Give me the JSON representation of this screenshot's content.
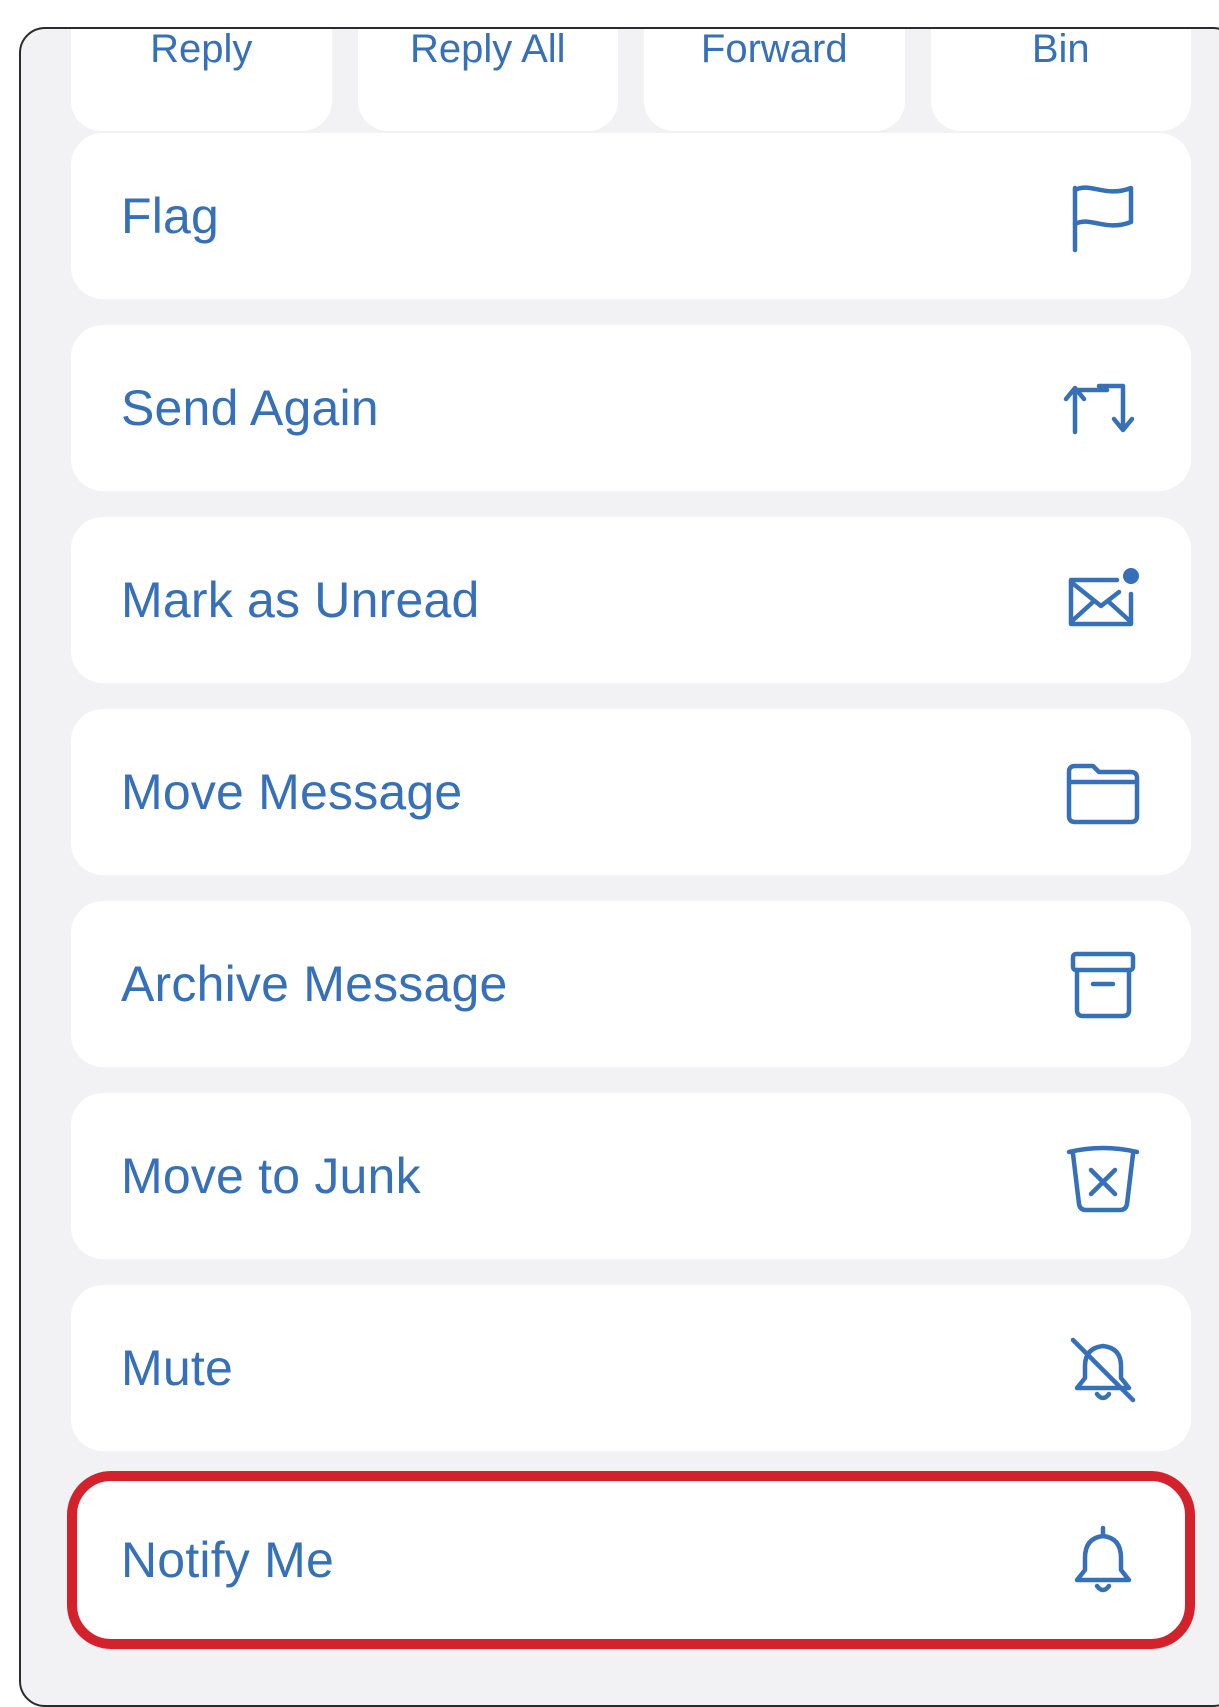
{
  "top_actions": [
    {
      "label": "Reply"
    },
    {
      "label": "Reply All"
    },
    {
      "label": "Forward"
    },
    {
      "label": "Bin"
    }
  ],
  "menu": {
    "items": [
      {
        "label": "Flag",
        "icon": "flag-icon"
      },
      {
        "label": "Send Again",
        "icon": "send-again-icon"
      },
      {
        "label": "Mark as Unread",
        "icon": "unread-envelope-icon"
      },
      {
        "label": "Move Message",
        "icon": "folder-icon"
      },
      {
        "label": "Archive Message",
        "icon": "archive-box-icon"
      },
      {
        "label": "Move to Junk",
        "icon": "junk-bin-icon"
      },
      {
        "label": "Mute",
        "icon": "bell-slash-icon"
      },
      {
        "label": "Notify Me",
        "icon": "bell-icon",
        "highlighted": true
      }
    ]
  },
  "colors": {
    "accent": "#3570b8",
    "highlight": "#d3222c",
    "background": "#f2f2f5",
    "card": "#ffffff"
  }
}
